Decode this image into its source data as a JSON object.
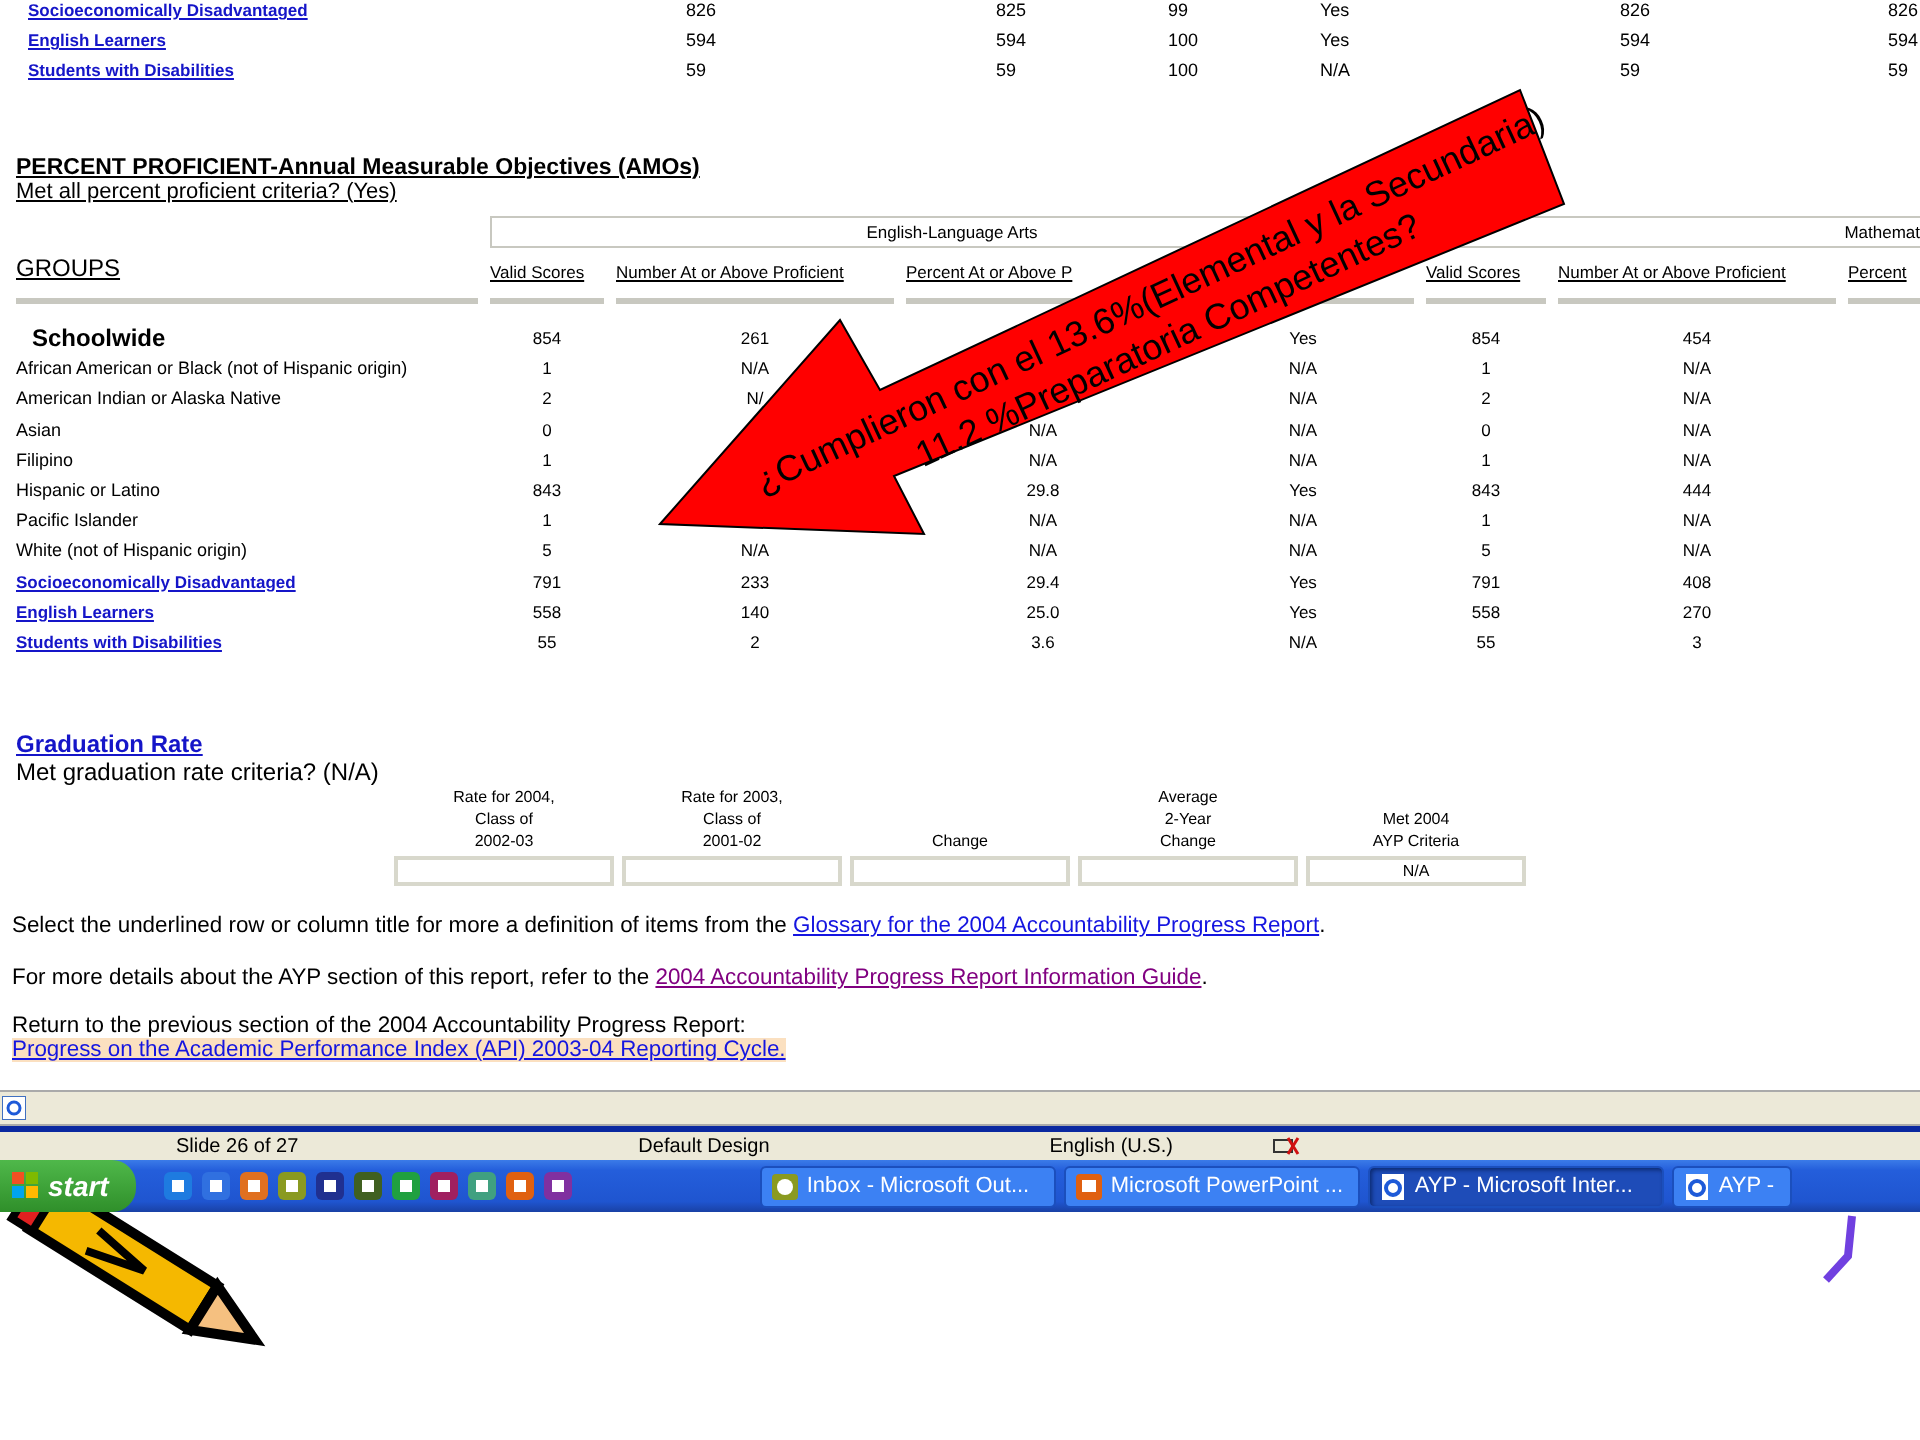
{
  "top_table": {
    "rows": [
      {
        "group": "Socioeconomically Disadvantaged",
        "cells": [
          "826",
          "825",
          "99",
          "Yes",
          "826",
          "826"
        ]
      },
      {
        "group": "English Learners",
        "cells": [
          "594",
          "594",
          "100",
          "Yes",
          "594",
          "594"
        ]
      },
      {
        "group": "Students with Disabilities",
        "cells": [
          "59",
          "59",
          "100",
          "N/A",
          "59",
          "59"
        ]
      }
    ]
  },
  "proficient": {
    "title": "PERCENT PROFICIENT-Annual Measurable Objectives (AMOs)",
    "subtitle": "Met all percent proficient criteria? (Yes)",
    "groups_label": "GROUPS",
    "ela_label": "English-Language Arts",
    "math_label": "Mathemat",
    "columns": [
      "Valid Scores",
      "Number At or Above Proficient",
      "Percent At or Above P",
      null,
      "Valid Scores",
      "Number At or Above Proficient",
      "Percent"
    ],
    "rows": [
      {
        "kind": "heading",
        "group": "Schoolwide",
        "cells": [
          "854",
          "261",
          null,
          "Yes",
          "854",
          "454"
        ]
      },
      {
        "kind": "plain",
        "group": "African American or Black (not of Hispanic origin)",
        "cells": [
          "1",
          "N/A",
          null,
          "N/A",
          "1",
          "N/A"
        ]
      },
      {
        "kind": "plain",
        "group": "American Indian or Alaska Native",
        "cells": [
          "2",
          "N/",
          null,
          "N/A",
          "2",
          "N/A"
        ]
      },
      {
        "kind": "plain",
        "group": "Asian",
        "cells": [
          "0",
          null,
          "N/A",
          "N/A",
          "0",
          "N/A"
        ]
      },
      {
        "kind": "plain",
        "group": "Filipino",
        "cells": [
          "1",
          null,
          "N/A",
          "N/A",
          "1",
          "N/A"
        ]
      },
      {
        "kind": "plain",
        "group": "Hispanic or Latino",
        "cells": [
          "843",
          null,
          "29.8",
          "Yes",
          "843",
          "444"
        ]
      },
      {
        "kind": "plain",
        "group": "Pacific Islander",
        "cells": [
          "1",
          null,
          "N/A",
          "N/A",
          "1",
          "N/A"
        ]
      },
      {
        "kind": "plain",
        "group": "White (not of Hispanic origin)",
        "cells": [
          "5",
          "N/A",
          "N/A",
          "N/A",
          "5",
          "N/A"
        ]
      },
      {
        "kind": "link",
        "group": "Socioeconomically Disadvantaged",
        "cells": [
          "791",
          "233",
          "29.4",
          "Yes",
          "791",
          "408"
        ]
      },
      {
        "kind": "link",
        "group": "English Learners",
        "cells": [
          "558",
          "140",
          "25.0",
          "Yes",
          "558",
          "270"
        ]
      },
      {
        "kind": "link",
        "group": "Students with Disabilities",
        "cells": [
          "55",
          "2",
          "3.6",
          "N/A",
          "55",
          "3"
        ]
      }
    ]
  },
  "callout": {
    "lines": [
      "¿Cumplieron con el 13.6%(Elemental y la Secundaria)",
      "11.2 %Preparatoria Competentes?"
    ]
  },
  "graduation": {
    "title": "Graduation Rate",
    "subtitle": "Met graduation rate criteria? (N/A)",
    "columns": [
      {
        "lines": [
          "Rate for 2004,",
          "Class of",
          "2002-03"
        ]
      },
      {
        "lines": [
          "Rate for 2003,",
          "Class of",
          "2001-02"
        ]
      },
      {
        "lines": [
          "Change"
        ]
      },
      {
        "lines": [
          "Average",
          "2-Year",
          "Change"
        ]
      },
      {
        "lines": [
          "Met 2004",
          "AYP Criteria"
        ],
        "value": "N/A"
      }
    ]
  },
  "notes": [
    {
      "text": "Select the underlined row or column title for more a definition of items from the ",
      "link": "Glossary for the 2004 Accountability Progress Report",
      "after": ".",
      "visited": false
    },
    {
      "text": "For more details about the AYP section of this report, refer to the ",
      "link": "2004 Accountability Progress Report Information Guide",
      "after": ".",
      "visited": true
    }
  ],
  "return": {
    "text": "Return to the previous section of the 2004 Accountability Progress Report:",
    "link": "Progress on the Academic Performance Index (API) 2003-04 Reporting Cycle."
  },
  "ppt_status": {
    "slide": "Slide 26 of 27",
    "design": "Default Design",
    "language": "English (U.S.)"
  },
  "taskbar": {
    "start": "start",
    "tasks": [
      {
        "label": "Inbox - Microsoft Out...",
        "kind": "mail",
        "selected": false
      },
      {
        "label": "Microsoft PowerPoint ...",
        "kind": "slides",
        "selected": false
      },
      {
        "label": "AYP - Microsoft Inter...",
        "kind": "browser",
        "selected": true
      },
      {
        "label": "AYP -",
        "kind": "browser",
        "selected": false
      }
    ]
  }
}
